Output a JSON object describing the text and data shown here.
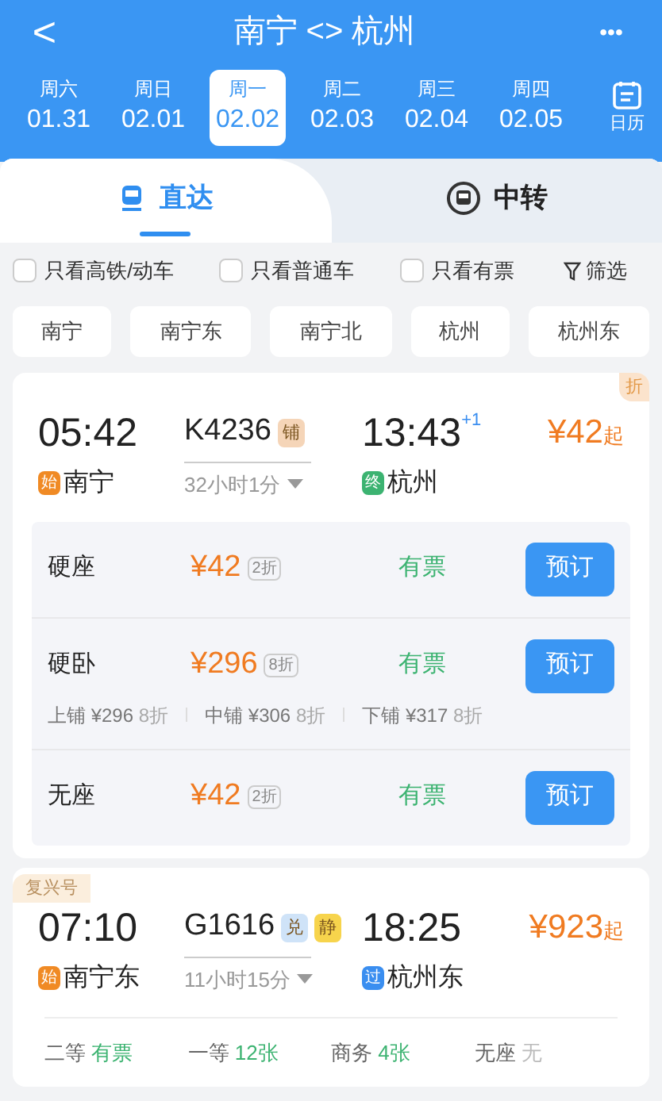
{
  "header": {
    "back": "<",
    "title": "南宁 <> 杭州",
    "more": "•••"
  },
  "dates": [
    {
      "weekday": "周六",
      "date": "01.31",
      "selected": false
    },
    {
      "weekday": "周日",
      "date": "02.01",
      "selected": false
    },
    {
      "weekday": "周一",
      "date": "02.02",
      "selected": true
    },
    {
      "weekday": "周二",
      "date": "02.03",
      "selected": false
    },
    {
      "weekday": "周三",
      "date": "02.04",
      "selected": false
    },
    {
      "weekday": "周四",
      "date": "02.05",
      "selected": false
    }
  ],
  "calendar": {
    "label": "日历"
  },
  "modes": [
    {
      "label": "直达",
      "kind": "direct",
      "selected": true
    },
    {
      "label": "中转",
      "kind": "transfer",
      "selected": false
    }
  ],
  "filters": [
    {
      "label": "只看高铁/动车",
      "checked": false
    },
    {
      "label": "只看普通车",
      "checked": false
    },
    {
      "label": "只看有票",
      "checked": false
    }
  ],
  "filter_button": "筛选",
  "stations": [
    "南宁",
    "南宁东",
    "南宁北",
    "杭州",
    "杭州东"
  ],
  "trains": [
    {
      "corner_tag": "折",
      "depart_time": "05:42",
      "number": "K4236",
      "train_tags": [
        {
          "text": "铺",
          "color": "#f5d5b8"
        }
      ],
      "arrive_time": "13:43",
      "day_offset": "+1",
      "price": "¥42",
      "price_suffix": "起",
      "from_badge": {
        "text": "始",
        "color": "#f08a24"
      },
      "from": "南宁",
      "duration": "32小时1分",
      "to_badge": {
        "text": "终",
        "color": "#3cb371"
      },
      "to": "杭州",
      "seats": [
        {
          "name": "硬座",
          "price": "¥42",
          "discount": "2折",
          "status": "有票",
          "button": "预订"
        },
        {
          "name": "硬卧",
          "price": "¥296",
          "discount": "8折",
          "status": "有票",
          "button": "预订",
          "berths": [
            {
              "label": "上铺 ¥296",
              "discount": "8折"
            },
            {
              "label": "中铺 ¥306",
              "discount": "8折"
            },
            {
              "label": "下铺 ¥317",
              "discount": "8折"
            }
          ]
        },
        {
          "name": "无座",
          "price": "¥42",
          "discount": "2折",
          "status": "有票",
          "button": "预订"
        }
      ]
    },
    {
      "top_tag": "复兴号",
      "depart_time": "07:10",
      "number": "G1616",
      "train_tags": [
        {
          "text": "兑",
          "color": "#cfe3f8"
        },
        {
          "text": "静",
          "color": "#f7d44c"
        }
      ],
      "arrive_time": "18:25",
      "price": "¥923",
      "price_suffix": "起",
      "from_badge": {
        "text": "始",
        "color": "#f08a24"
      },
      "from": "南宁东",
      "duration": "11小时15分",
      "to_badge": {
        "text": "过",
        "color": "#3a8ef0"
      },
      "to": "杭州东",
      "classes": [
        {
          "name": "二等",
          "availability": "有票",
          "available": true
        },
        {
          "name": "一等",
          "availability": "12张",
          "available": true
        },
        {
          "name": "商务",
          "availability": "4张",
          "available": true
        },
        {
          "name": "无座",
          "availability": "无",
          "available": false
        }
      ]
    }
  ]
}
